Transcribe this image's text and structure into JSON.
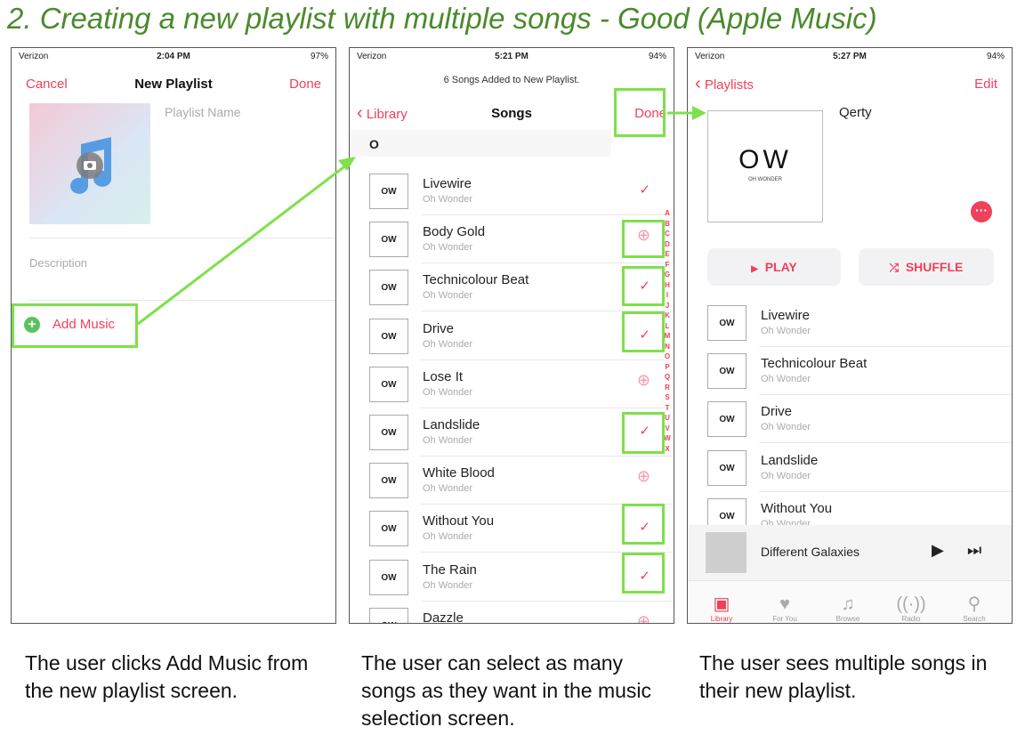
{
  "title": "2. Creating a new playlist with multiple songs - Good (Apple Music)",
  "colors": {
    "accent_red": "#f0405a",
    "highlight_green": "#7ee04b",
    "title_green": "#4a8a2c"
  },
  "screen1": {
    "carrier": "Verizon",
    "time": "2:04 PM",
    "battery": "97%",
    "cancel": "Cancel",
    "nav_title": "New Playlist",
    "done": "Done",
    "playlist_name_placeholder": "Playlist Name",
    "description_placeholder": "Description",
    "add_music": "Add Music",
    "caption": "The user clicks Add Music from the new playlist screen."
  },
  "screen2": {
    "carrier": "Verizon",
    "time": "5:21 PM",
    "battery": "94%",
    "banner": "6 Songs Added to New Playlist.",
    "back": "Library",
    "nav_title": "Songs",
    "done": "Done",
    "section": "O",
    "thumb": "OW",
    "songs": [
      {
        "title": "Livewire",
        "artist": "Oh Wonder",
        "state": "✓"
      },
      {
        "title": "Body Gold",
        "artist": "Oh Wonder",
        "state": "⊕"
      },
      {
        "title": "Technicolour Beat",
        "artist": "Oh Wonder",
        "state": "✓"
      },
      {
        "title": "Drive",
        "artist": "Oh Wonder",
        "state": "✓"
      },
      {
        "title": "Lose It",
        "artist": "Oh Wonder",
        "state": "⊕"
      },
      {
        "title": "Landslide",
        "artist": "Oh Wonder",
        "state": "✓"
      },
      {
        "title": "White Blood",
        "artist": "Oh Wonder",
        "state": "⊕"
      },
      {
        "title": "Without You",
        "artist": "Oh Wonder",
        "state": "✓"
      },
      {
        "title": "The Rain",
        "artist": "Oh Wonder",
        "state": "✓"
      },
      {
        "title": "Dazzle",
        "artist": "",
        "state": "⊕"
      }
    ],
    "index_letters": [
      "A",
      "B",
      "C",
      "D",
      "E",
      "F",
      "G",
      "H",
      "I",
      "J",
      "K",
      "L",
      "M",
      "N",
      "O",
      "P",
      "Q",
      "R",
      "S",
      "T",
      "U",
      "V",
      "W",
      "X"
    ],
    "caption": "The user can select as many songs as they want in the music selection screen."
  },
  "screen3": {
    "carrier": "Verizon",
    "time": "5:27 PM",
    "battery": "94%",
    "back": "Playlists",
    "edit": "Edit",
    "playlist_title": "Qerty",
    "art_text": "OW",
    "art_subtext": "OH WONDER",
    "play": "PLAY",
    "shuffle": "SHUFFLE",
    "thumb": "OW",
    "songs": [
      {
        "title": "Livewire",
        "artist": "Oh Wonder"
      },
      {
        "title": "Technicolour Beat",
        "artist": "Oh Wonder"
      },
      {
        "title": "Drive",
        "artist": "Oh Wonder"
      },
      {
        "title": "Landslide",
        "artist": "Oh Wonder"
      },
      {
        "title": "Without You",
        "artist": "Oh Wonder"
      }
    ],
    "now_playing": "Different Galaxies",
    "tabs": [
      {
        "icon": "library-icon",
        "glyph": "▣",
        "label": "Library",
        "active": true
      },
      {
        "icon": "heart-icon",
        "glyph": "♥",
        "label": "For You",
        "active": false
      },
      {
        "icon": "music-note-icon",
        "glyph": "♫",
        "label": "Browse",
        "active": false
      },
      {
        "icon": "radio-icon",
        "glyph": "((·))",
        "label": "Radio",
        "active": false
      },
      {
        "icon": "search-icon",
        "glyph": "⚲",
        "label": "Search",
        "active": false
      }
    ],
    "caption": "The user sees multiple songs in their new playlist."
  }
}
